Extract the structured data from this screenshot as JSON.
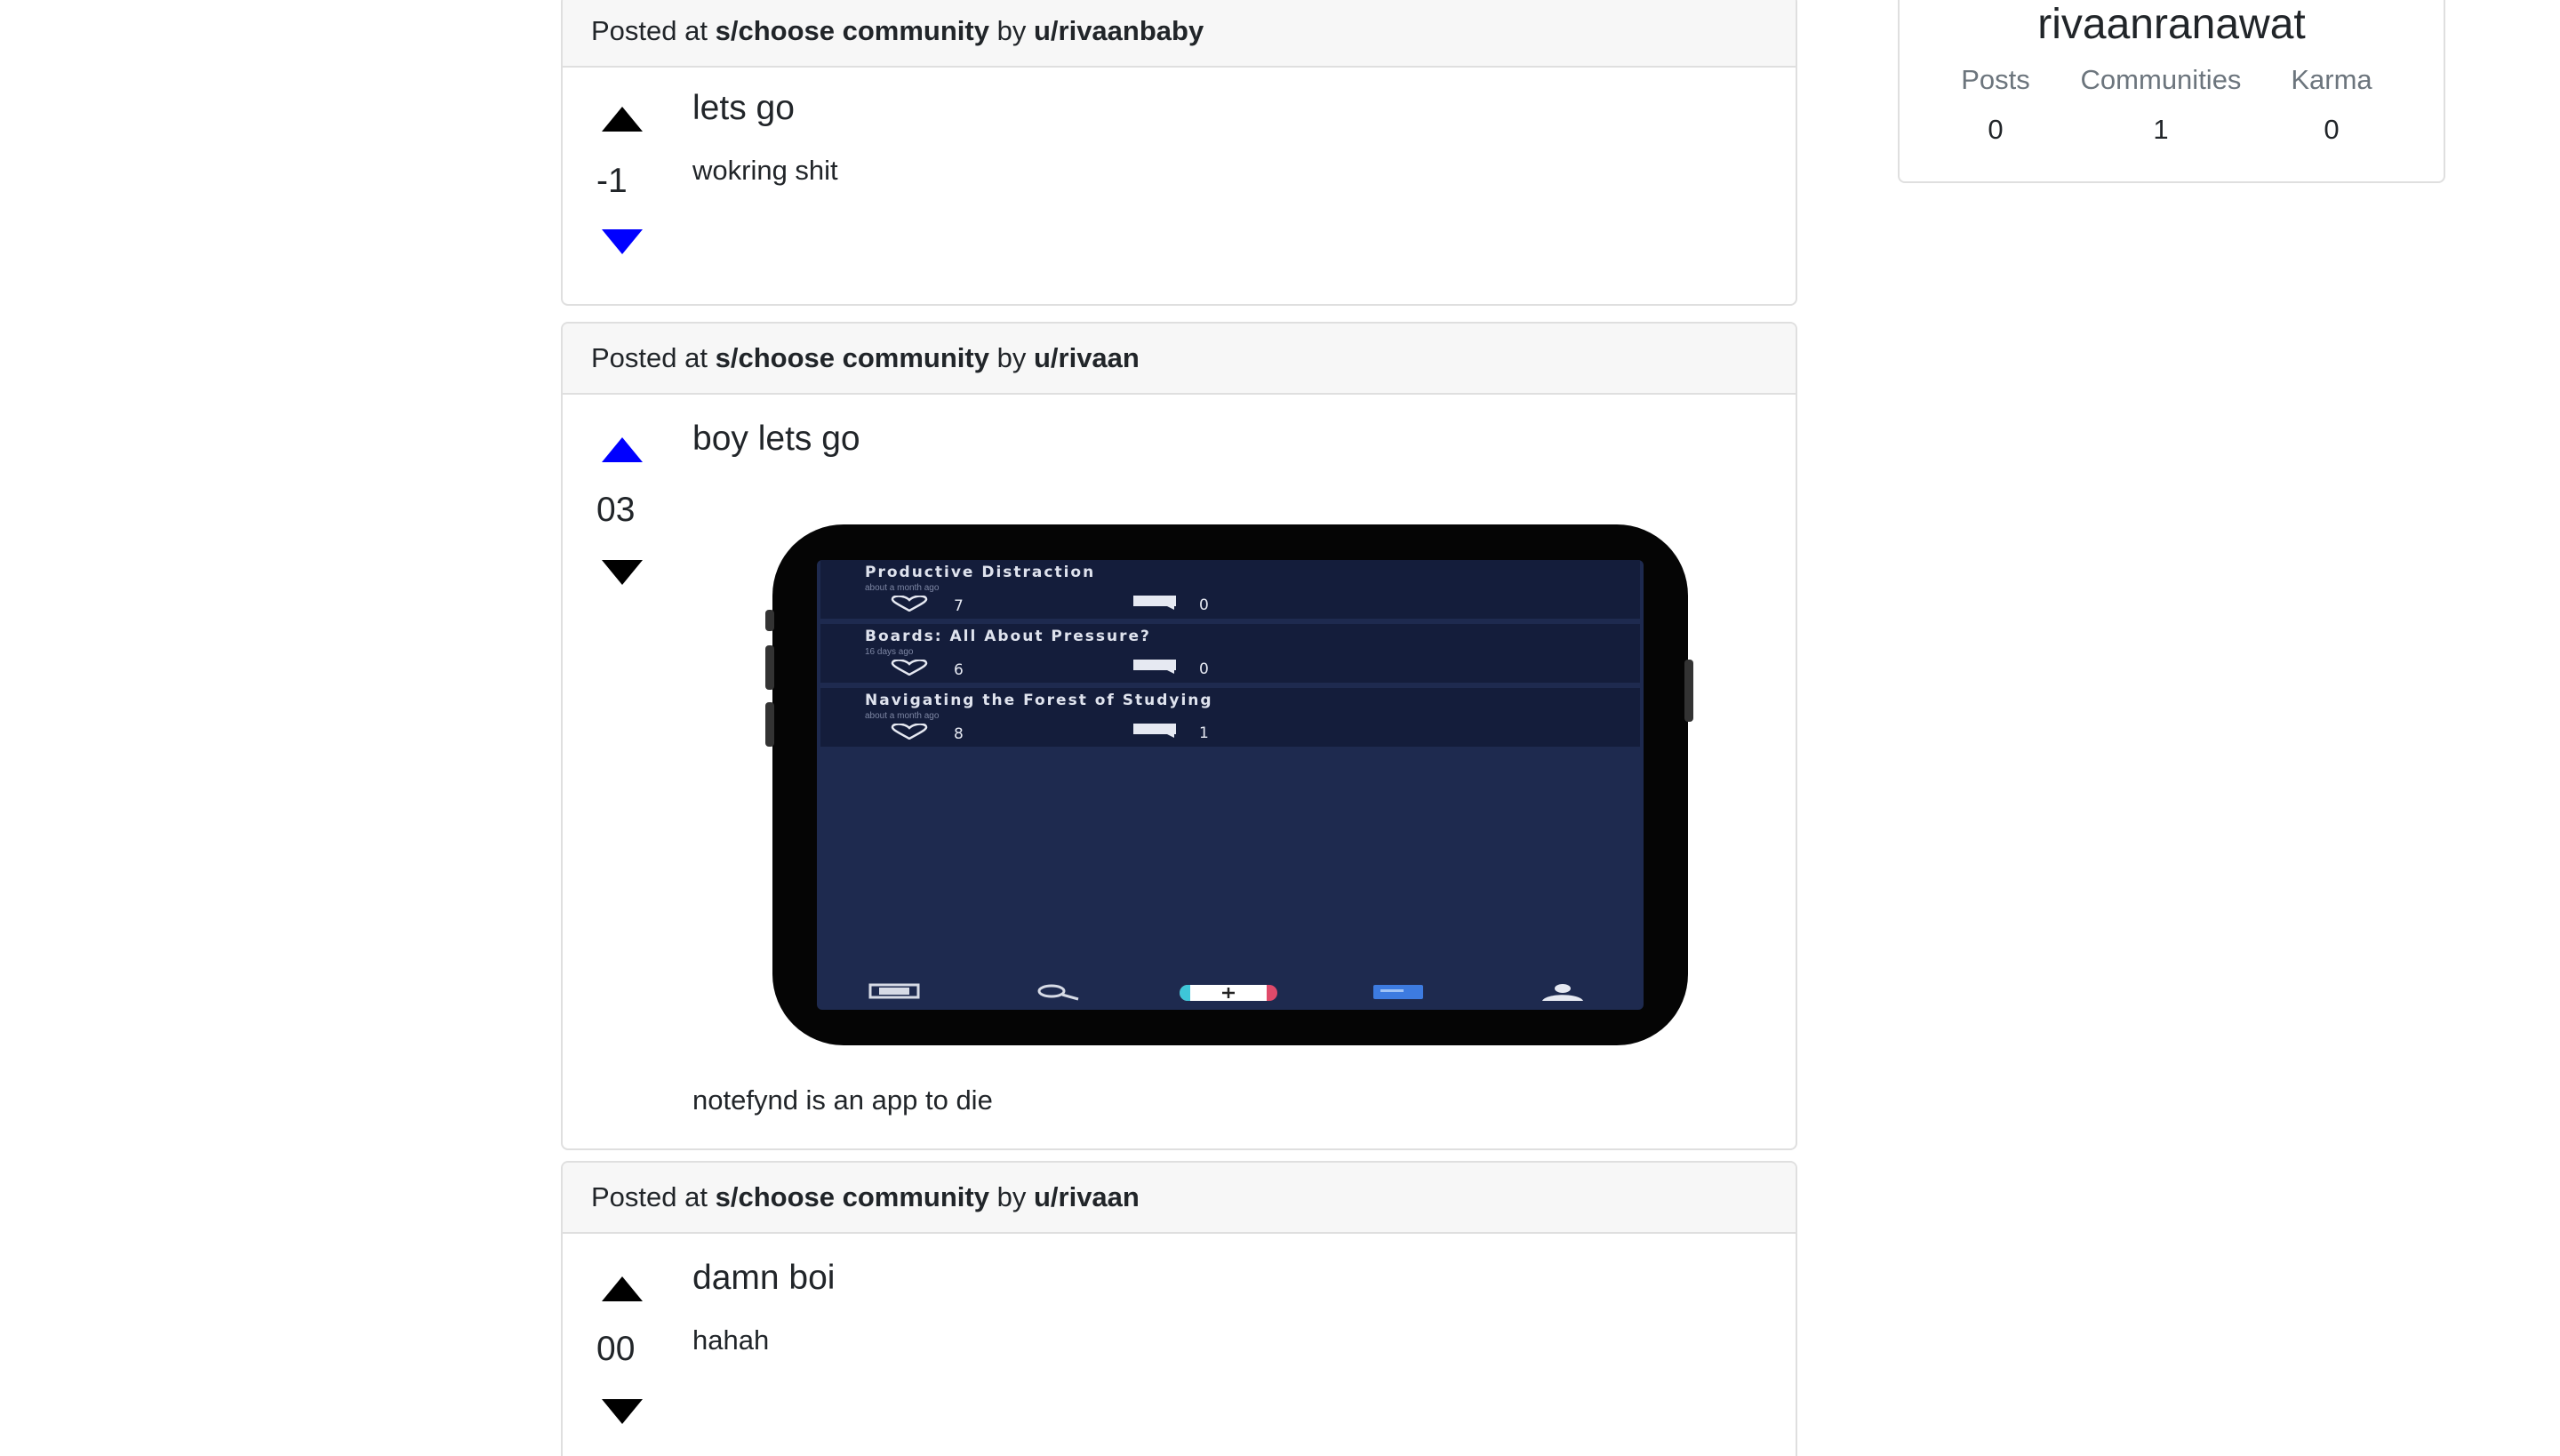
{
  "posts": [
    {
      "posted_at": "Posted at",
      "community": "s/choose community",
      "by": "by",
      "user": "u/rivaanbaby",
      "score": "-1",
      "title": "lets go",
      "body": "wokring shit",
      "vote": "down"
    },
    {
      "posted_at": "Posted at",
      "community": "s/choose community",
      "by": "by",
      "user": "u/rivaan",
      "score": "03",
      "title": "boy lets go",
      "body": "notefynd is an app to die",
      "vote": "up",
      "image": {
        "feed": [
          {
            "title": "Productive Distraction",
            "sub": "about a month ago",
            "likes": "7",
            "comments": "0"
          },
          {
            "title": "Boards: All About Pressure?",
            "sub": "16 days ago",
            "likes": "6",
            "comments": "0"
          },
          {
            "title": "Navigating the Forest of Studying",
            "sub": "about a month ago",
            "likes": "8",
            "comments": "1"
          }
        ],
        "tab_icons": [
          "pdf-icon",
          "search-icon",
          "add-icon",
          "notes-icon",
          "profile-icon"
        ]
      }
    },
    {
      "posted_at": "Posted at",
      "community": "s/choose community",
      "by": "by",
      "user": "u/rivaan",
      "score": "00",
      "title": "damn boi",
      "body": "hahah",
      "vote": "none"
    }
  ],
  "profile": {
    "username": "rivaanranawat",
    "stats": [
      {
        "label": "Posts",
        "value": "0"
      },
      {
        "label": "Communities",
        "value": "1"
      },
      {
        "label": "Karma",
        "value": "0"
      }
    ]
  },
  "colors": {
    "vote_active": "#0000ff",
    "vote_inactive": "#000000",
    "header_bg": "#f7f7f7",
    "border": "#dfdfdf",
    "muted_text": "#6c757d",
    "phone_screen": "#1e2a4f",
    "feed_item": "#141d3b"
  }
}
